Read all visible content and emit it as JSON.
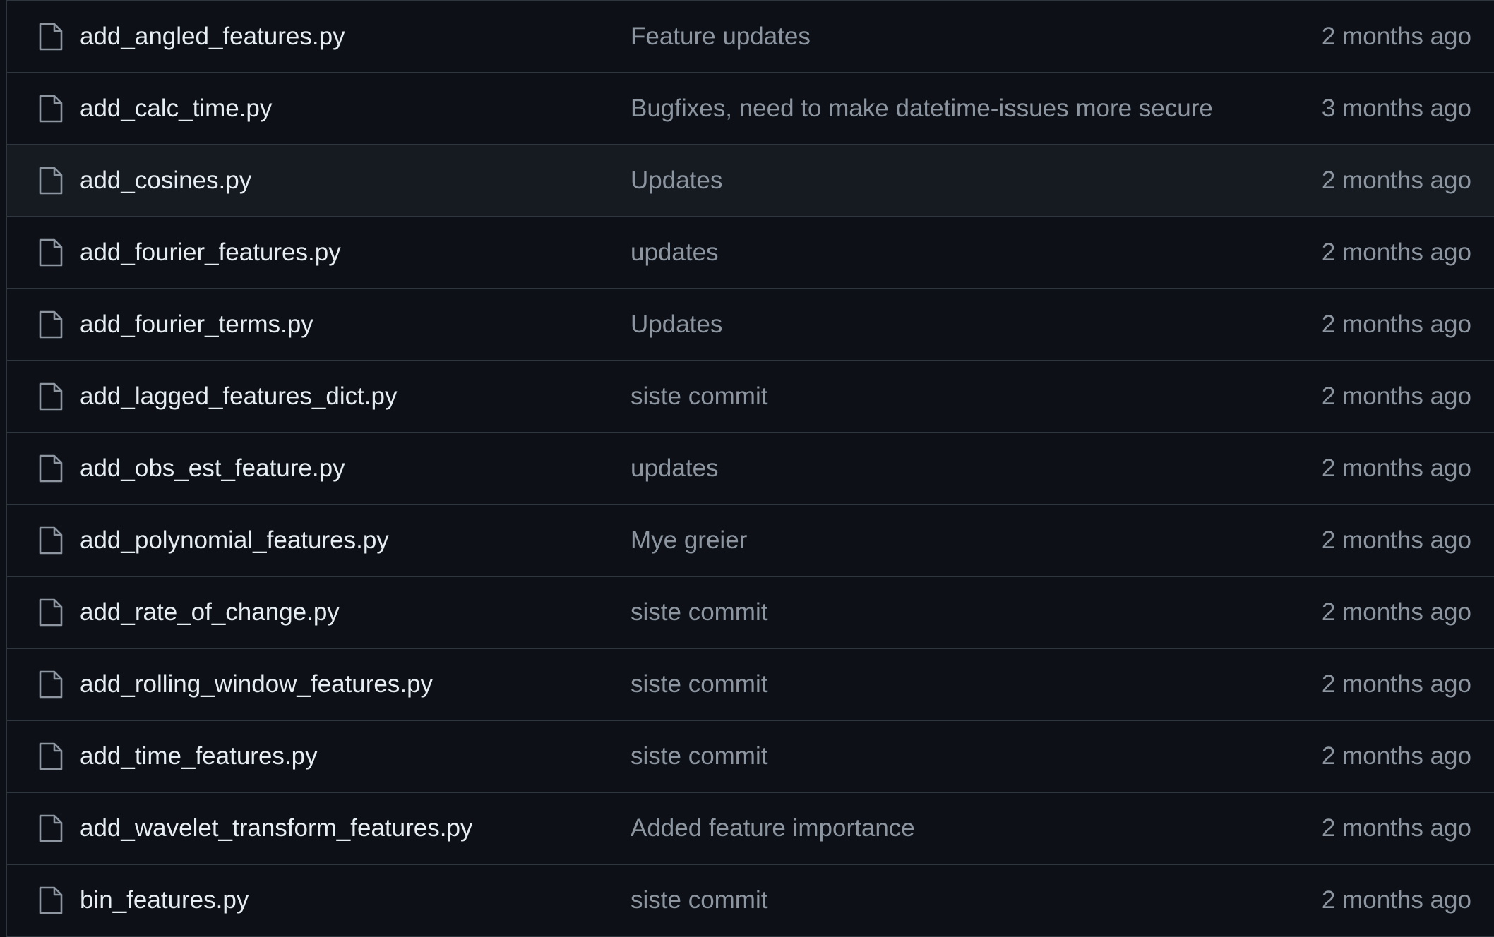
{
  "colors": {
    "background": "#0d1117",
    "row_hover": "#161b22",
    "border": "#30363d",
    "filename": "#e6edf3",
    "muted": "#8d96a0"
  },
  "icon": "file-icon",
  "files": [
    {
      "name": "add_angled_features.py",
      "commit": "Feature updates",
      "age": "2 months ago"
    },
    {
      "name": "add_calc_time.py",
      "commit": "Bugfixes, need to make datetime-issues more secure",
      "age": "3 months ago"
    },
    {
      "name": "add_cosines.py",
      "commit": "Updates",
      "age": "2 months ago"
    },
    {
      "name": "add_fourier_features.py",
      "commit": "updates",
      "age": "2 months ago"
    },
    {
      "name": "add_fourier_terms.py",
      "commit": "Updates",
      "age": "2 months ago"
    },
    {
      "name": "add_lagged_features_dict.py",
      "commit": "siste commit",
      "age": "2 months ago"
    },
    {
      "name": "add_obs_est_feature.py",
      "commit": "updates",
      "age": "2 months ago"
    },
    {
      "name": "add_polynomial_features.py",
      "commit": "Mye greier",
      "age": "2 months ago"
    },
    {
      "name": "add_rate_of_change.py",
      "commit": "siste commit",
      "age": "2 months ago"
    },
    {
      "name": "add_rolling_window_features.py",
      "commit": "siste commit",
      "age": "2 months ago"
    },
    {
      "name": "add_time_features.py",
      "commit": "siste commit",
      "age": "2 months ago"
    },
    {
      "name": "add_wavelet_transform_features.py",
      "commit": "Added feature importance",
      "age": "2 months ago"
    },
    {
      "name": "bin_features.py",
      "commit": "siste commit",
      "age": "2 months ago"
    }
  ]
}
